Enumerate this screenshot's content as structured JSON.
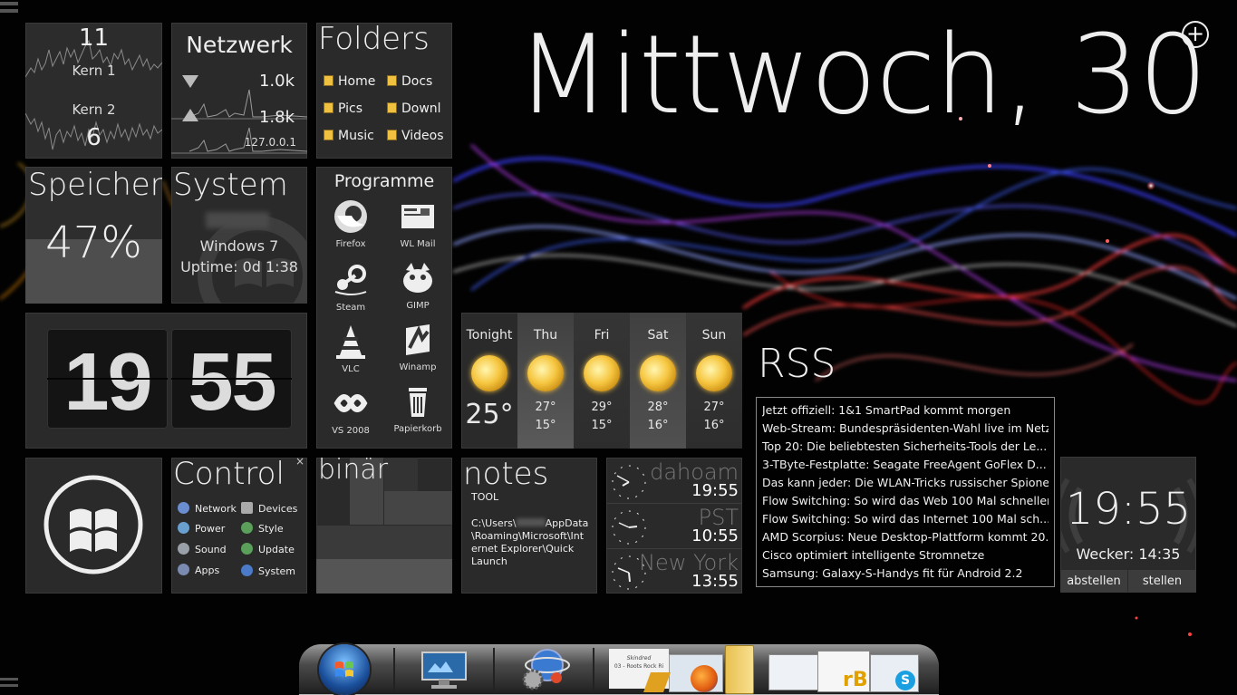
{
  "date": {
    "text": "Mittwoch, 30",
    "add_glyph": "+"
  },
  "cpu": {
    "core1_value": "11",
    "core1_label": "Kern 1",
    "core2_label": "Kern 2",
    "core2_value": "6"
  },
  "network": {
    "title": "Netzwerk",
    "down": "1.0k",
    "up": "1.8k",
    "ip": "127.0.0.1"
  },
  "folders": {
    "title": "Folders",
    "items": [
      "Home",
      "Docs",
      "Pics",
      "Downl",
      "Music",
      "Videos"
    ]
  },
  "memory": {
    "title": "Speicher",
    "percent_text": "47%",
    "percent": 0.47
  },
  "system": {
    "title": "System",
    "os": "Windows 7",
    "uptime": "Uptime: 0d 1:38"
  },
  "programs": {
    "title": "Programme",
    "items": [
      {
        "label": "Firefox",
        "icon": "firefox-icon"
      },
      {
        "label": "WL Mail",
        "icon": "mail-icon"
      },
      {
        "label": "Steam",
        "icon": "steam-icon"
      },
      {
        "label": "GIMP",
        "icon": "gimp-icon"
      },
      {
        "label": "VLC",
        "icon": "vlc-cone-icon"
      },
      {
        "label": "Winamp",
        "icon": "winamp-icon"
      },
      {
        "label": "VS 2008",
        "icon": "visual-studio-icon"
      },
      {
        "label": "Papierkorb",
        "icon": "recycle-bin-icon"
      }
    ]
  },
  "clock_flip": {
    "hours": "19",
    "minutes": "55"
  },
  "weather": {
    "days": [
      {
        "name": "Tonight",
        "temp": "25°"
      },
      {
        "name": "Thu",
        "high": "27°",
        "low": "15°"
      },
      {
        "name": "Fri",
        "high": "29°",
        "low": "15°"
      },
      {
        "name": "Sat",
        "high": "28°",
        "low": "16°"
      },
      {
        "name": "Sun",
        "high": "27°",
        "low": "16°"
      }
    ]
  },
  "rss": {
    "title": "RSS",
    "items": [
      "Jetzt offiziell: 1&1 SmartPad kommt morgen",
      "Web-Stream: Bundespräsidenten-Wahl live im Netz",
      "Top 20: Die beliebtesten Sicherheits-Tools der Le...",
      "3-TByte-Festplatte: Seagate FreeAgent GoFlex D...",
      "Das kann jeder: Die WLAN-Tricks russischer Spione",
      "Flow Switching: So wird das Web 100 Mal schneller",
      "Flow Switching: So wird das Internet 100 Mal sch...",
      "AMD Scorpius: Neue Desktop-Plattform kommt 20...",
      "Cisco optimiert intelligente Stromnetze",
      "Samsung: Galaxy-S-Handys fit für Android 2.2"
    ]
  },
  "control": {
    "title": "Control",
    "close_glyph": "×",
    "items": [
      "Network",
      "Devices",
      "Power",
      "Style",
      "Sound",
      "Update",
      "Apps",
      "System"
    ]
  },
  "binary": {
    "title": "binär"
  },
  "notes": {
    "title": "notes",
    "subtitle": "TOOL",
    "path_a": "C:\\Users\\",
    "path_b": "AppData",
    "path_c": "\\Roaming\\Microsoft\\Int",
    "path_d": "ernet Explorer\\Quick",
    "path_e": "Launch"
  },
  "world_clocks": [
    {
      "city": "dahoam",
      "time": "19:55"
    },
    {
      "city": "PST",
      "time": "10:55"
    },
    {
      "city": "New York",
      "time": "13:55"
    }
  ],
  "alarm": {
    "time": "19:55",
    "label": "Wecker: 14:35",
    "dismiss": "abstellen",
    "set": "stellen"
  },
  "dock": {
    "item_title": "Skindred",
    "item_sub": "03 - Roots Rock Ri",
    "rb_label": "rB"
  }
}
